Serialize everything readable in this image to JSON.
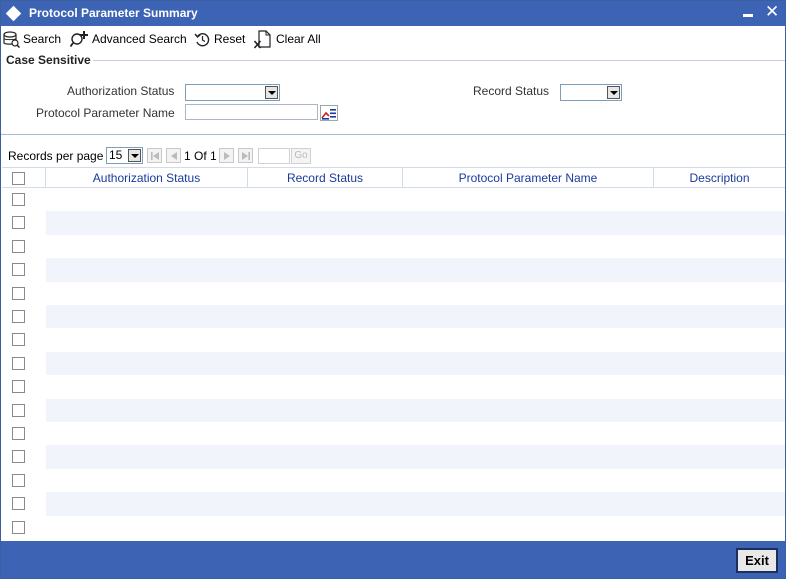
{
  "window": {
    "title": "Protocol Parameter Summary"
  },
  "toolbar": {
    "search": "Search",
    "advanced_search": "Advanced Search",
    "reset": "Reset",
    "clear_all": "Clear All"
  },
  "criteria": {
    "legend": "Case Sensitive",
    "authorization_status_label": "Authorization Status",
    "authorization_status_value": "",
    "record_status_label": "Record Status",
    "record_status_value": "",
    "protocol_parameter_name_label": "Protocol Parameter Name",
    "protocol_parameter_name_value": ""
  },
  "pager": {
    "records_per_page_label": "Records per page",
    "records_per_page_value": "15",
    "page_info": "1 Of 1",
    "goto_value": "",
    "go_label": "Go"
  },
  "grid": {
    "columns": [
      "Authorization Status",
      "Record Status",
      "Protocol Parameter Name",
      "Description"
    ],
    "empty_row_count": 15
  },
  "footer": {
    "exit_label": "Exit"
  },
  "colors": {
    "titlebar": "#3d63b5",
    "header_text": "#1a3a9c",
    "alt_row": "#f1f4fa"
  }
}
